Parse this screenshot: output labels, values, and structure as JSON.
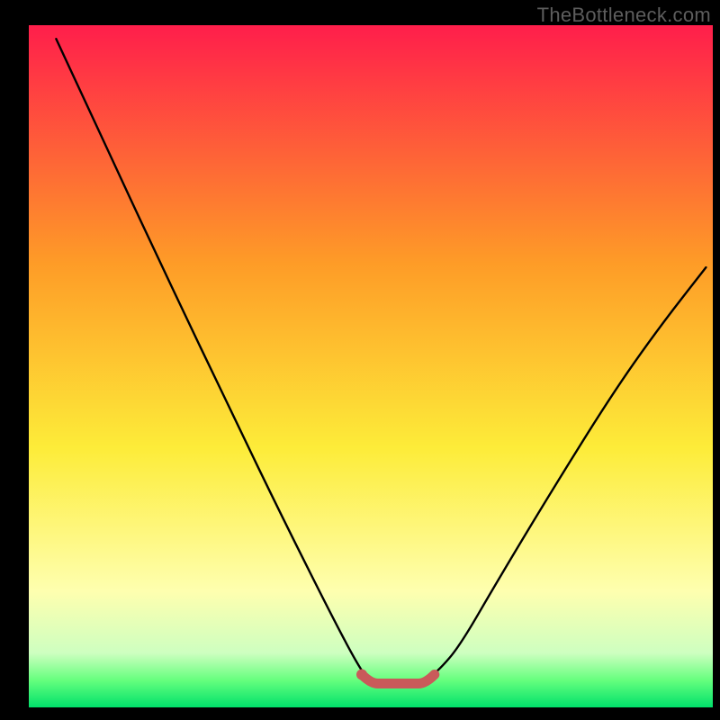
{
  "watermark": "TheBottleneck.com",
  "colors": {
    "background_black": "#000000",
    "grad_red": "#ff1e4b",
    "grad_orange": "#fe9c27",
    "grad_yellow": "#fdec39",
    "grad_pale_yellow": "#feffaf",
    "grad_green": "#66ff7e",
    "grad_deep_green": "#00e06a",
    "line_black": "#000000",
    "flat_segment": "#c95a5a"
  },
  "chart_data": {
    "type": "line",
    "title": "",
    "xlabel": "",
    "ylabel": "",
    "xlim": [
      0,
      100
    ],
    "ylim": [
      0,
      100
    ],
    "series": [
      {
        "name": "curve",
        "x": [
          4,
          10,
          20,
          30,
          37,
          44.5,
          48.5,
          50,
          54,
          58,
          60,
          63,
          68.5,
          76,
          85,
          92,
          99
        ],
        "values": [
          98,
          85,
          63.5,
          42.5,
          28,
          13,
          5.5,
          3.8,
          3.2,
          4,
          5.5,
          9,
          18.5,
          31,
          45.5,
          55.5,
          64.5
        ]
      }
    ],
    "flat_segment": {
      "x_start": 50,
      "x_end": 58,
      "y": 3.5
    }
  }
}
